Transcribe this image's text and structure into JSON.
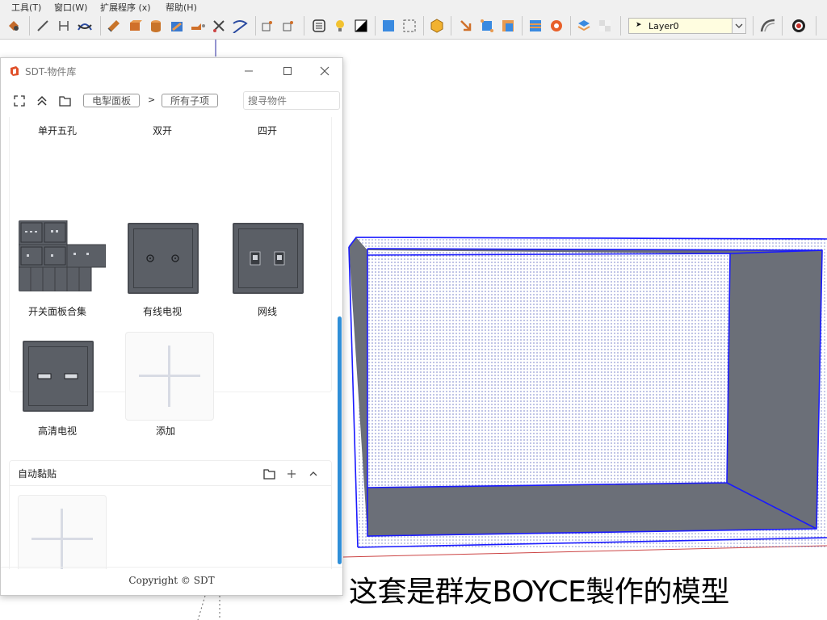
{
  "menubar": {
    "items": [
      "工具(T)",
      "窗口(W)",
      "扩展程序 (x)",
      "帮助(H)"
    ]
  },
  "toolbar": {
    "layer": {
      "value": "Layer0"
    }
  },
  "panel": {
    "title": "SDT-物件库",
    "breadcrumb": {
      "category": "电掣面板",
      "separator": ">",
      "subcategory": "所有子项"
    },
    "search_placeholder": "搜寻物件",
    "items": [
      {
        "label": "单开五孔"
      },
      {
        "label": "双开"
      },
      {
        "label": "四开"
      },
      {
        "label": "开关面板合集"
      },
      {
        "label": "有线电视"
      },
      {
        "label": "网线"
      },
      {
        "label": "高清电视"
      },
      {
        "label": "添加"
      }
    ],
    "section2": {
      "title": "自动黏贴",
      "add_label": "添加"
    },
    "copyright": "Copyright © SDT"
  },
  "caption": "这套是群友BOYCE製作的模型",
  "colors": {
    "selection_blue": "#1a1aff",
    "plate_gray": "#5b5f66",
    "scrollbar": "#2f8fd8",
    "layer_bg": "#fffde0"
  }
}
